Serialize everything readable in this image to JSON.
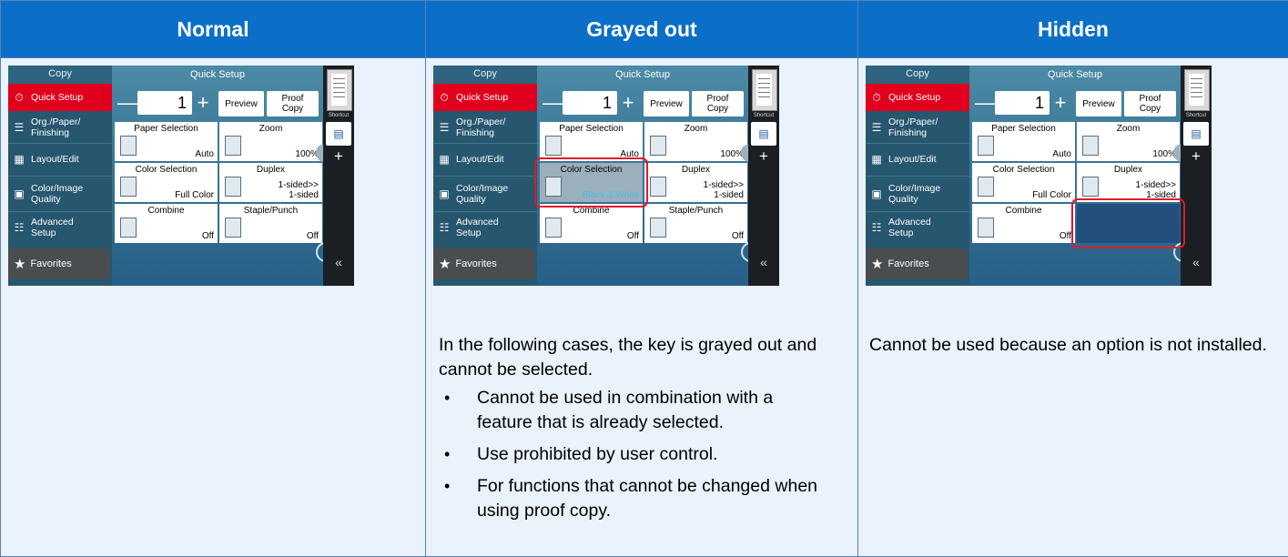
{
  "columns": [
    {
      "header": "Normal"
    },
    {
      "header": "Grayed out"
    },
    {
      "header": "Hidden"
    }
  ],
  "screen": {
    "copy": "Copy",
    "quick_setup_title": "Quick Setup",
    "left_items": [
      "Quick Setup",
      "Org./Paper/",
      "Finishing",
      "Layout/Edit",
      "Color/Image",
      "Quality",
      "Advanced",
      "Setup"
    ],
    "favorites": "Favorites",
    "count": "1",
    "minus": "—",
    "plus": "+",
    "preview": "Preview",
    "proof_line1": "Proof",
    "proof_line2": "Copy",
    "paper_selection": "Paper Selection",
    "paper_value": "Auto",
    "zoom": "Zoom",
    "zoom_value": "100%",
    "color_selection": "Color Selection",
    "color_value": "Full Color",
    "color_value_gray": "Black & White",
    "duplex": "Duplex",
    "duplex_value1": "1-sided>>",
    "duplex_value2": "1-sided",
    "combine": "Combine",
    "combine_value": "Off",
    "staple": "Staple/Punch",
    "staple_value": "Off",
    "shortcut": "Shortcut",
    "collapse": "«"
  },
  "grayed_text": {
    "intro": "In the following cases, the key is grayed out and cannot be selected.",
    "bullets": [
      "Cannot be used in combination with a feature that is already selected.",
      "Use prohibited by user control.",
      "For functions that cannot be changed when using proof copy."
    ]
  },
  "hidden_text": "Cannot be used because an option is not installed.",
  "colors": {
    "header_bg": "#0b6fc8",
    "cell_bg": "#eaf2fb",
    "highlight": "#e01a2a",
    "quick_setup_red": "#e0001d"
  }
}
